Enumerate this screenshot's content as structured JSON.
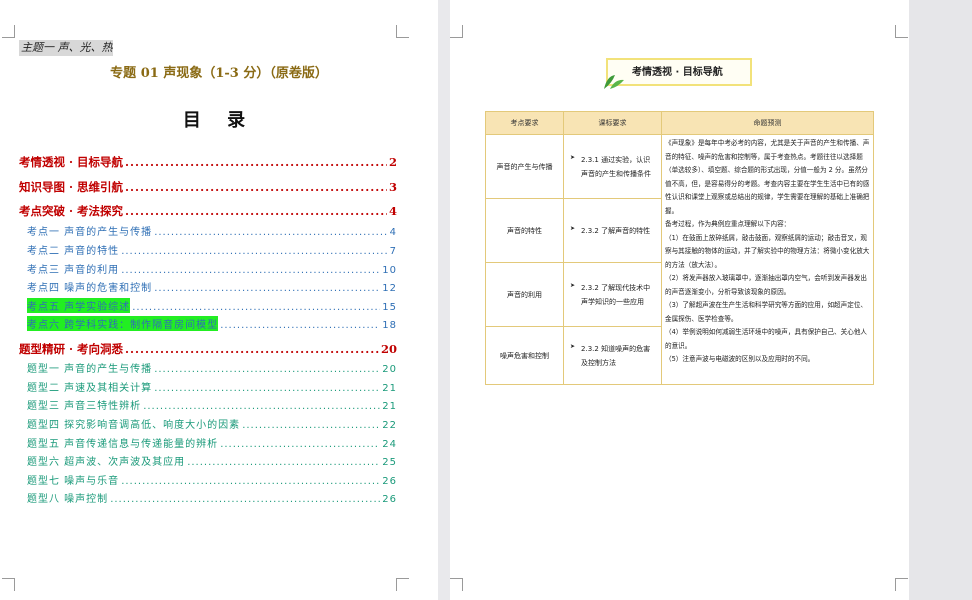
{
  "left_page": {
    "header_tag": "主题一  声、光、热",
    "doc_title": "专题 01    声现象（1-3 分）（原卷版）",
    "toc_heading": "目  录",
    "toc": [
      {
        "text": "考情透视 · 目标导航",
        "page": "2",
        "level": 1,
        "color": "#c00000"
      },
      {
        "text": "知识导图 · 思维引航",
        "page": "3",
        "level": 1,
        "color": "#c00000"
      },
      {
        "text": "考点突破 · 考法探究",
        "page": "4",
        "level": 1,
        "color": "#c00000"
      },
      {
        "text": "考点一   声音的产生与传播",
        "page": "4",
        "level": 2,
        "color": "#2f6fb5"
      },
      {
        "text": "考点二   声音的特性",
        "page": "7",
        "level": 2,
        "color": "#2f6fb5"
      },
      {
        "text": "考点三   声音的利用",
        "page": "10",
        "level": 2,
        "color": "#2f6fb5"
      },
      {
        "text": "考点四   噪声的危害和控制",
        "page": "12",
        "level": 2,
        "color": "#2f6fb5"
      },
      {
        "text": "考点五   声学实验综述",
        "page": "15",
        "level": 2,
        "color": "#2f6fb5",
        "highlight": true
      },
      {
        "text": "考点六   跨学科实践：制作隔音房间模型",
        "page": "18",
        "level": 2,
        "color": "#2f6fb5",
        "highlight": true
      },
      {
        "text": "题型精研 · 考向洞悉",
        "page": "20",
        "level": 1,
        "color": "#c00000"
      },
      {
        "text": "题型一   声音的产生与传播",
        "page": "20",
        "level": 2,
        "color": "#1a9a7a"
      },
      {
        "text": "题型二   声速及其相关计算",
        "page": "21",
        "level": 2,
        "color": "#1a9a7a"
      },
      {
        "text": "题型三   声音三特性辨析",
        "page": "21",
        "level": 2,
        "color": "#1a9a7a"
      },
      {
        "text": "题型四   探究影响音调高低、响度大小的因素",
        "page": "22",
        "level": 2,
        "color": "#1a9a7a"
      },
      {
        "text": "题型五   声音传递信息与传递能量的辨析",
        "page": "24",
        "level": 2,
        "color": "#1a9a7a"
      },
      {
        "text": "题型六   超声波、次声波及其应用",
        "page": "25",
        "level": 2,
        "color": "#1a9a7a"
      },
      {
        "text": "题型七   噪声与乐音",
        "page": "26",
        "level": 2,
        "color": "#1a9a7a"
      },
      {
        "text": "题型八   噪声控制",
        "page": "26",
        "level": 2,
        "color": "#1a9a7a"
      }
    ]
  },
  "right_page": {
    "banner": "考情透视 · 目标导航",
    "table": {
      "headers": [
        "考点要求",
        "课标要求",
        "命题预测"
      ],
      "rows": [
        {
          "topic": "声音的产生与传播",
          "standard": "2.3.1 通过实验，认识声音的产生和传播条件"
        },
        {
          "topic": "声音的特性",
          "standard": "2.3.2 了解声音的特性"
        },
        {
          "topic": "声音的利用",
          "standard": "2.3.2 了解现代技术中声学知识的一些应用"
        },
        {
          "topic": "噪声危害和控制",
          "standard": "2.3.2 知道噪声的危害及控制方法"
        }
      ],
      "prediction": [
        "《声现象》是每年中考必考的内容，尤其是关于声音的产生和传播、声音的特征、噪声的危害和控制等，属于考查热点。考题往往以选择题（单选较多）、填空题、综合题的形式出现，分值一般为 2 分。虽然分值不高，但，是容易得分的考题。考查内容主要在学生生活中已有的感性认识和课堂上观察或总结出的规律，学生需要在理解的基础上准确把握。",
        "备考过程，作为典例应重点理解以下内容：",
        "（1）在鼓面上放碎纸屑，敲击鼓面，观察纸屑的运动；敲击音叉，观察与其接触的物体的运动，并了解实验中的物理方法：将微小变化放大的方法（放大法）。",
        "（2）将发声器放入玻璃罩中，逐渐抽出罩内空气，会听到发声器发出的声音逐渐变小，分析导致该现象的原因。",
        "（3）了解超声波在生产生活和科学研究等方面的应用，如超声定位、金属探伤、医学检查等。",
        "（4）举例说明如何减弱生活环境中的噪声，具有保护自己、关心他人的意识。",
        "（5）注意声波与电磁波的区别以及应用时的不同。"
      ]
    }
  }
}
